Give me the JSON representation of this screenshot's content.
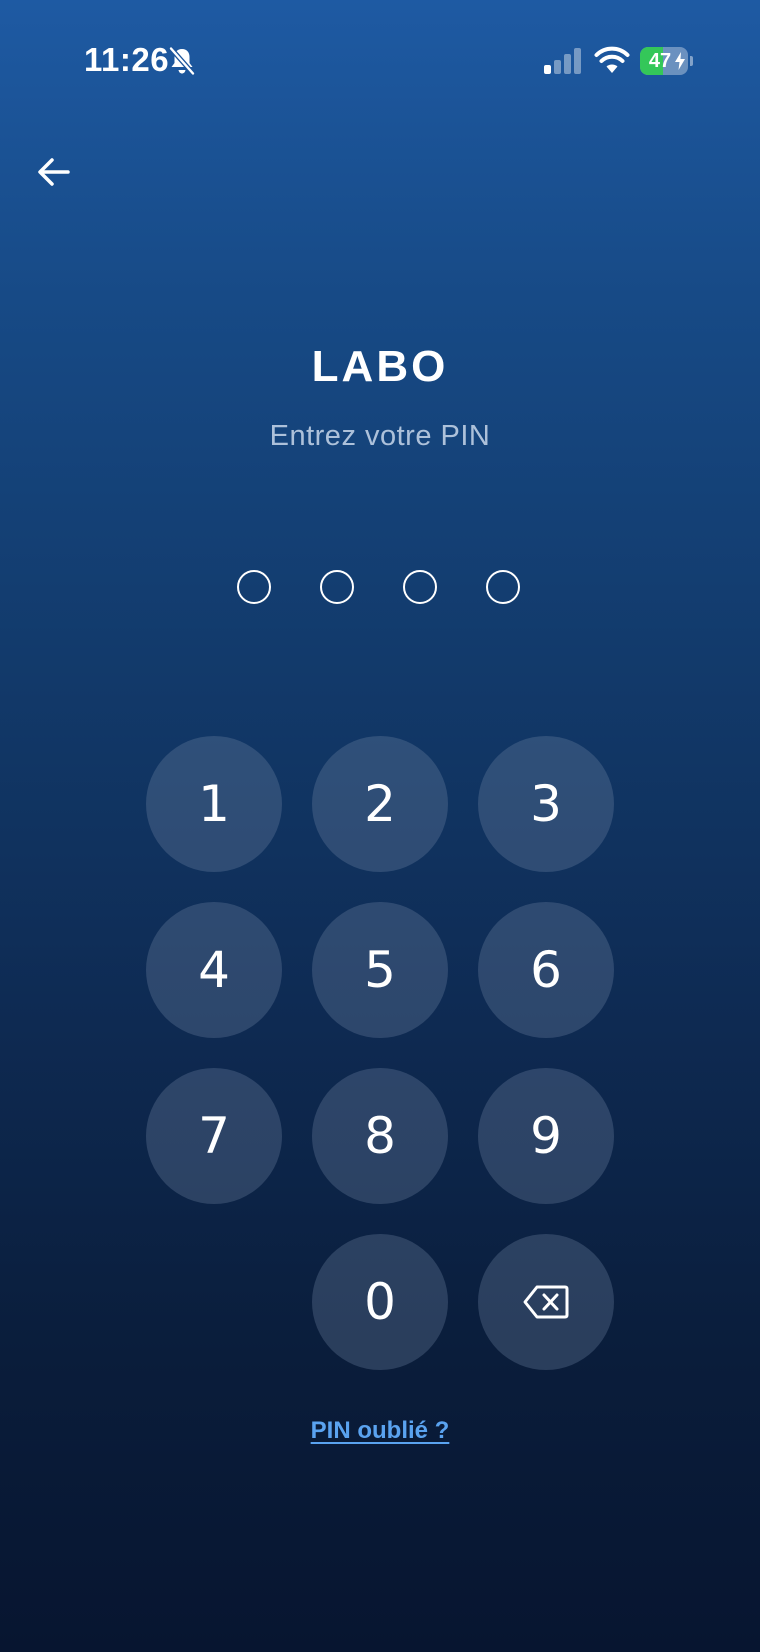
{
  "status_bar": {
    "time": "11:26",
    "battery_level": "47",
    "battery_fraction": 0.47,
    "battery_charging": true,
    "icons": [
      "bell-slash-icon",
      "cellular-signal-icon",
      "wifi-icon",
      "battery-icon",
      "charging-bolt-icon"
    ]
  },
  "nav": {
    "back_icon": "arrow-left-icon"
  },
  "header": {
    "title": "LABO",
    "subtitle": "Entrez votre PIN"
  },
  "pin": {
    "length": 4,
    "entered": 0
  },
  "keypad": {
    "keys": [
      "1",
      "2",
      "3",
      "4",
      "5",
      "6",
      "7",
      "8",
      "9",
      "0"
    ],
    "delete_icon": "backspace-icon"
  },
  "footer": {
    "forgot_label": "PIN oublié ?"
  },
  "colors": {
    "background_top": "#1e5aa3",
    "background_bottom": "#071530",
    "key_fill": "rgba(120,140,170,0.30)",
    "link": "#5aa3f0",
    "battery_green": "#34c759"
  }
}
